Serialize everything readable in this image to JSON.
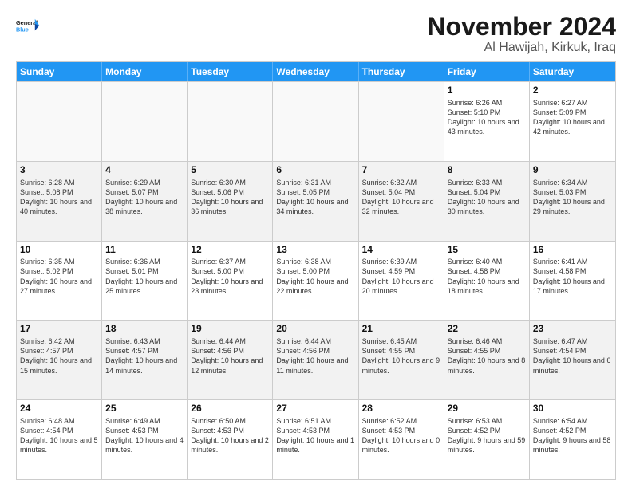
{
  "logo": {
    "line1": "General",
    "line2": "Blue"
  },
  "header": {
    "month": "November 2024",
    "location": "Al Hawijah, Kirkuk, Iraq"
  },
  "weekdays": [
    "Sunday",
    "Monday",
    "Tuesday",
    "Wednesday",
    "Thursday",
    "Friday",
    "Saturday"
  ],
  "rows": [
    [
      {
        "day": "",
        "empty": true
      },
      {
        "day": "",
        "empty": true
      },
      {
        "day": "",
        "empty": true
      },
      {
        "day": "",
        "empty": true
      },
      {
        "day": "",
        "empty": true
      },
      {
        "day": "1",
        "info": "Sunrise: 6:26 AM\nSunset: 5:10 PM\nDaylight: 10 hours\nand 43 minutes."
      },
      {
        "day": "2",
        "info": "Sunrise: 6:27 AM\nSunset: 5:09 PM\nDaylight: 10 hours\nand 42 minutes."
      }
    ],
    [
      {
        "day": "3",
        "info": "Sunrise: 6:28 AM\nSunset: 5:08 PM\nDaylight: 10 hours\nand 40 minutes."
      },
      {
        "day": "4",
        "info": "Sunrise: 6:29 AM\nSunset: 5:07 PM\nDaylight: 10 hours\nand 38 minutes."
      },
      {
        "day": "5",
        "info": "Sunrise: 6:30 AM\nSunset: 5:06 PM\nDaylight: 10 hours\nand 36 minutes."
      },
      {
        "day": "6",
        "info": "Sunrise: 6:31 AM\nSunset: 5:05 PM\nDaylight: 10 hours\nand 34 minutes."
      },
      {
        "day": "7",
        "info": "Sunrise: 6:32 AM\nSunset: 5:04 PM\nDaylight: 10 hours\nand 32 minutes."
      },
      {
        "day": "8",
        "info": "Sunrise: 6:33 AM\nSunset: 5:04 PM\nDaylight: 10 hours\nand 30 minutes."
      },
      {
        "day": "9",
        "info": "Sunrise: 6:34 AM\nSunset: 5:03 PM\nDaylight: 10 hours\nand 29 minutes."
      }
    ],
    [
      {
        "day": "10",
        "info": "Sunrise: 6:35 AM\nSunset: 5:02 PM\nDaylight: 10 hours\nand 27 minutes."
      },
      {
        "day": "11",
        "info": "Sunrise: 6:36 AM\nSunset: 5:01 PM\nDaylight: 10 hours\nand 25 minutes."
      },
      {
        "day": "12",
        "info": "Sunrise: 6:37 AM\nSunset: 5:00 PM\nDaylight: 10 hours\nand 23 minutes."
      },
      {
        "day": "13",
        "info": "Sunrise: 6:38 AM\nSunset: 5:00 PM\nDaylight: 10 hours\nand 22 minutes."
      },
      {
        "day": "14",
        "info": "Sunrise: 6:39 AM\nSunset: 4:59 PM\nDaylight: 10 hours\nand 20 minutes."
      },
      {
        "day": "15",
        "info": "Sunrise: 6:40 AM\nSunset: 4:58 PM\nDaylight: 10 hours\nand 18 minutes."
      },
      {
        "day": "16",
        "info": "Sunrise: 6:41 AM\nSunset: 4:58 PM\nDaylight: 10 hours\nand 17 minutes."
      }
    ],
    [
      {
        "day": "17",
        "info": "Sunrise: 6:42 AM\nSunset: 4:57 PM\nDaylight: 10 hours\nand 15 minutes."
      },
      {
        "day": "18",
        "info": "Sunrise: 6:43 AM\nSunset: 4:57 PM\nDaylight: 10 hours\nand 14 minutes."
      },
      {
        "day": "19",
        "info": "Sunrise: 6:44 AM\nSunset: 4:56 PM\nDaylight: 10 hours\nand 12 minutes."
      },
      {
        "day": "20",
        "info": "Sunrise: 6:44 AM\nSunset: 4:56 PM\nDaylight: 10 hours\nand 11 minutes."
      },
      {
        "day": "21",
        "info": "Sunrise: 6:45 AM\nSunset: 4:55 PM\nDaylight: 10 hours\nand 9 minutes."
      },
      {
        "day": "22",
        "info": "Sunrise: 6:46 AM\nSunset: 4:55 PM\nDaylight: 10 hours\nand 8 minutes."
      },
      {
        "day": "23",
        "info": "Sunrise: 6:47 AM\nSunset: 4:54 PM\nDaylight: 10 hours\nand 6 minutes."
      }
    ],
    [
      {
        "day": "24",
        "info": "Sunrise: 6:48 AM\nSunset: 4:54 PM\nDaylight: 10 hours\nand 5 minutes."
      },
      {
        "day": "25",
        "info": "Sunrise: 6:49 AM\nSunset: 4:53 PM\nDaylight: 10 hours\nand 4 minutes."
      },
      {
        "day": "26",
        "info": "Sunrise: 6:50 AM\nSunset: 4:53 PM\nDaylight: 10 hours\nand 2 minutes."
      },
      {
        "day": "27",
        "info": "Sunrise: 6:51 AM\nSunset: 4:53 PM\nDaylight: 10 hours\nand 1 minute."
      },
      {
        "day": "28",
        "info": "Sunrise: 6:52 AM\nSunset: 4:53 PM\nDaylight: 10 hours\nand 0 minutes."
      },
      {
        "day": "29",
        "info": "Sunrise: 6:53 AM\nSunset: 4:52 PM\nDaylight: 9 hours\nand 59 minutes."
      },
      {
        "day": "30",
        "info": "Sunrise: 6:54 AM\nSunset: 4:52 PM\nDaylight: 9 hours\nand 58 minutes."
      }
    ]
  ]
}
